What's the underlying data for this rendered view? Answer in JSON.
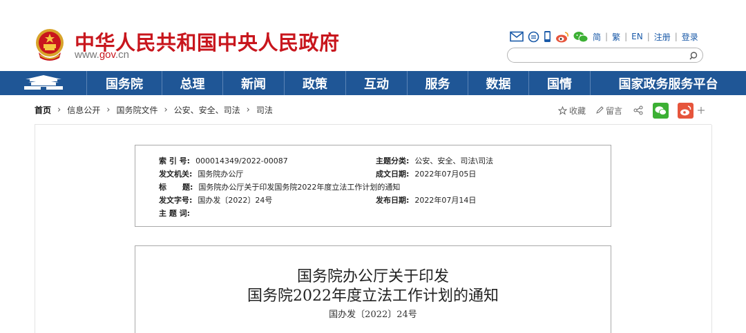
{
  "header": {
    "site_title": "中华人民共和国中央人民政府",
    "url_prefix": "www.",
    "url_domain": "gov",
    "url_suffix": ".cn",
    "top_icons": [
      "mail-icon",
      "message-icon",
      "mobile-icon",
      "weibo-icon",
      "wechat-icon"
    ],
    "links": [
      "简",
      "繁",
      "EN",
      "注册",
      "登录"
    ],
    "search_placeholder": ""
  },
  "nav": {
    "items": [
      "国务院",
      "总理",
      "新闻",
      "政策",
      "互动",
      "服务",
      "数据",
      "国情",
      "国家政务服务平台"
    ]
  },
  "breadcrumb": {
    "items": [
      "首页",
      "信息公开",
      "国务院文件",
      "公安、安全、司法",
      "司法"
    ]
  },
  "share": {
    "collect": "收藏",
    "comment": "留言"
  },
  "meta": {
    "index_label": "索 引 号:",
    "index_value": "000014349/2022-00087",
    "topic_label": "主题分类:",
    "topic_value": "公安、安全、司法\\司法",
    "issuer_label": "发文机关:",
    "issuer_value": "国务院办公厅",
    "date_label": "成文日期:",
    "date_value": "2022年07月05日",
    "title_label": "标      题:",
    "title_value": "国务院办公厅关于印发国务院2022年度立法工作计划的通知",
    "docno_label": "发文字号:",
    "docno_value": "国办发〔2022〕24号",
    "pubdate_label": "发布日期:",
    "pubdate_value": "2022年07月14日",
    "subject_label": "主 题 词:",
    "subject_value": ""
  },
  "doc": {
    "title_line1": "国务院办公厅关于印发",
    "title_line2": "国务院2022年度立法工作计划的通知",
    "doc_number": "国办发〔2022〕24号"
  },
  "colors": {
    "brand_red": "#c8161d",
    "nav_blue": "#1f5696",
    "link_blue": "#1a5aa8",
    "wechat_green": "#3cb034",
    "weibo_red": "#e6553c"
  }
}
